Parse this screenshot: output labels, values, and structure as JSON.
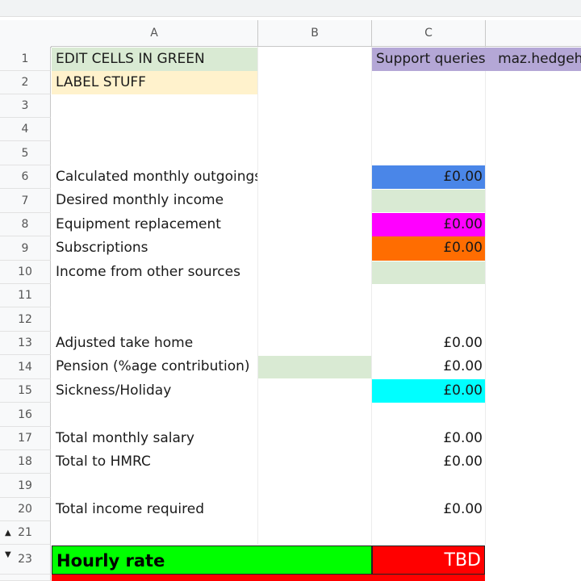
{
  "columns": [
    "A",
    "B",
    "C"
  ],
  "rows": [
    "1",
    "2",
    "3",
    "4",
    "5",
    "6",
    "7",
    "8",
    "9",
    "10",
    "11",
    "12",
    "13",
    "14",
    "15",
    "16",
    "17",
    "18",
    "19",
    "20",
    "21",
    "23"
  ],
  "header_cells": {
    "edit_cells": "EDIT CELLS IN GREEN",
    "label_stuff": "LABEL STUFF",
    "support_queries": "Support queries",
    "support_contact": "maz.hedgehog"
  },
  "labels": {
    "r6": "Calculated monthly outgoings",
    "r7": "Desired monthly income",
    "r8": "Equipment replacement",
    "r9": "Subscriptions",
    "r10": "Income from other sources",
    "r13": "Adjusted take home",
    "r14": "Pension (%age contribution)",
    "r15": "Sickness/Holiday",
    "r17": "Total monthly salary",
    "r18": "Total to HMRC",
    "r20": "Total income required",
    "r23": "Hourly rate"
  },
  "values": {
    "r6": "£0.00",
    "r8": "£0.00",
    "r9": "£0.00",
    "r13": "£0.00",
    "r14": "£0.00",
    "r15": "£0.00",
    "r17": "£0.00",
    "r18": "£0.00",
    "r20": "£0.00",
    "r23": "TBD"
  },
  "colors": {
    "edit_green": "#d9ead3",
    "label_yellow": "#fff2cc",
    "support_purple": "#b4a7d6",
    "blue": "#4a86e8",
    "magenta": "#ff00ff",
    "orange": "#ff6d01",
    "cyan": "#00ffff",
    "bright_green": "#00ff00",
    "red": "#ff0000"
  }
}
